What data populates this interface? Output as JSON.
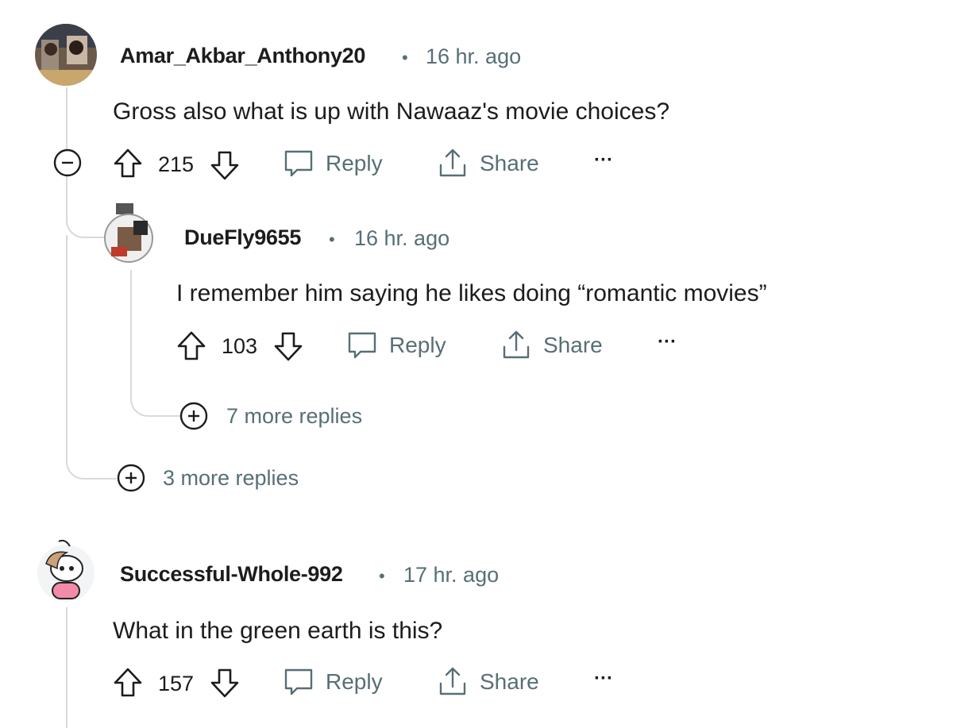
{
  "comments": [
    {
      "username": "Amar_Akbar_Anthony20",
      "separator": "•",
      "time": "16 hr. ago",
      "body": "Gross also what is up with Nawaaz's movie choices?",
      "score": "215",
      "reply_label": "Reply",
      "share_label": "Share",
      "more_label": "···"
    },
    {
      "username": "DueFly9655",
      "separator": "•",
      "time": "16 hr. ago",
      "body": "I remember him saying he likes doing “romantic movies”",
      "score": "103",
      "reply_label": "Reply",
      "share_label": "Share",
      "more_label": "···",
      "more_replies": "7 more replies"
    },
    {
      "username": "Successful-Whole-992",
      "separator": "•",
      "time": "17 hr. ago",
      "body": "What in the green earth is this?",
      "score": "157",
      "reply_label": "Reply",
      "share_label": "Share",
      "more_label": "···"
    }
  ],
  "parent_more_replies": "3 more replies",
  "colors": {
    "meta": "#576f76",
    "line": "#d7dadc",
    "text": "#1c1c1c"
  }
}
